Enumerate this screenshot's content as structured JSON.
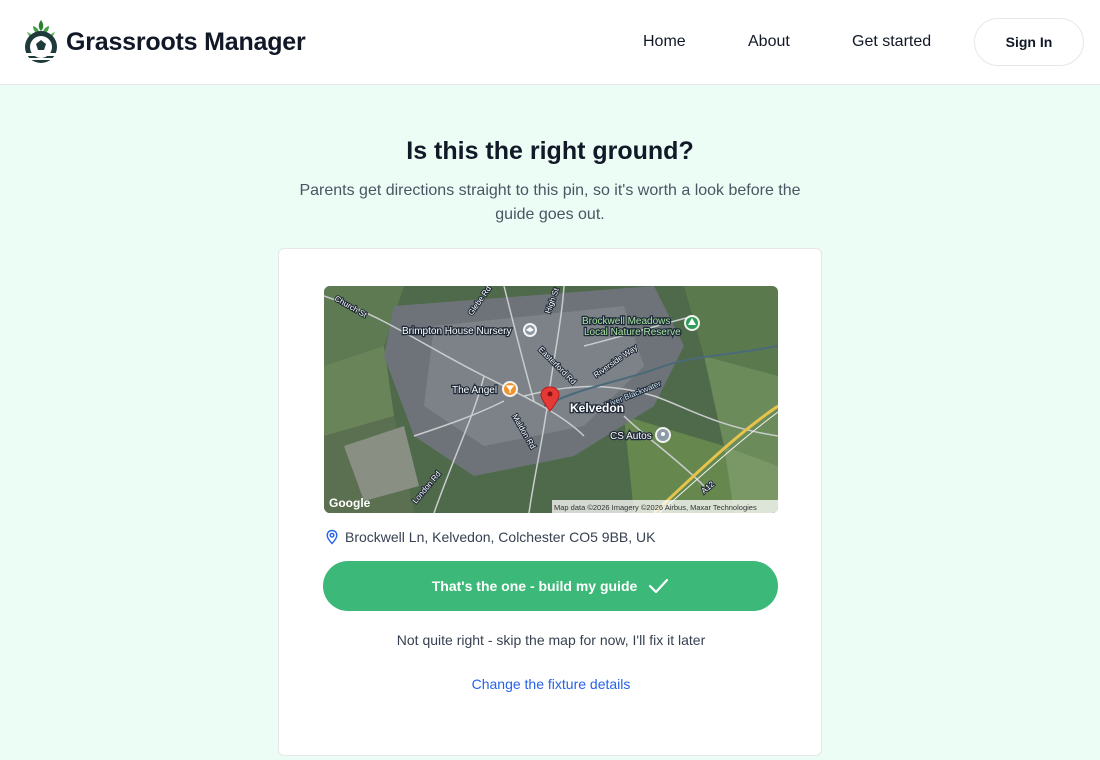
{
  "header": {
    "brand": "Grassroots Manager",
    "nav": [
      {
        "label": "Home"
      },
      {
        "label": "About"
      },
      {
        "label": "Get started"
      }
    ],
    "sign_in_label": "Sign In"
  },
  "page": {
    "title": "Is this the right ground?",
    "subtitle": "Parents get directions straight to this pin, so it's worth a look before the guide goes out."
  },
  "map": {
    "labels": {
      "nursery": "Brimpton House Nursery",
      "reserve_line1": "Brockwell Meadows",
      "reserve_line2": "Local Nature Reserve",
      "pub": "The Angel",
      "town": "Kelvedon",
      "garage": "CS Autos",
      "river": "River Blackwater",
      "road_church": "Church St",
      "road_glebe": "Glebe Rd",
      "road_high": "High St",
      "road_easterford": "Easterford Rd",
      "road_riverside": "Riverside Way",
      "road_maldon": "Maldon Rd",
      "road_london": "London Rd",
      "road_a12": "A12"
    },
    "provider_logo": "Google",
    "attribution": "Map data ©2026 Imagery ©2026 Airbus, Maxar Technologies",
    "icons": [
      "school-marker-icon",
      "park-marker-icon",
      "pub-marker-icon",
      "location-pin-icon",
      "place-marker-icon"
    ]
  },
  "card": {
    "address": "Brockwell Ln, Kelvedon, Colchester CO5 9BB, UK",
    "confirm_label": "That's the one - build my guide",
    "skip_label": "Not quite right - skip the map for now, I'll fix it later",
    "change_label": "Change the fixture details"
  },
  "colors": {
    "background": "#ecfdf5",
    "primary": "#3cb878",
    "link": "#2563eb",
    "pin": "#e53935"
  }
}
